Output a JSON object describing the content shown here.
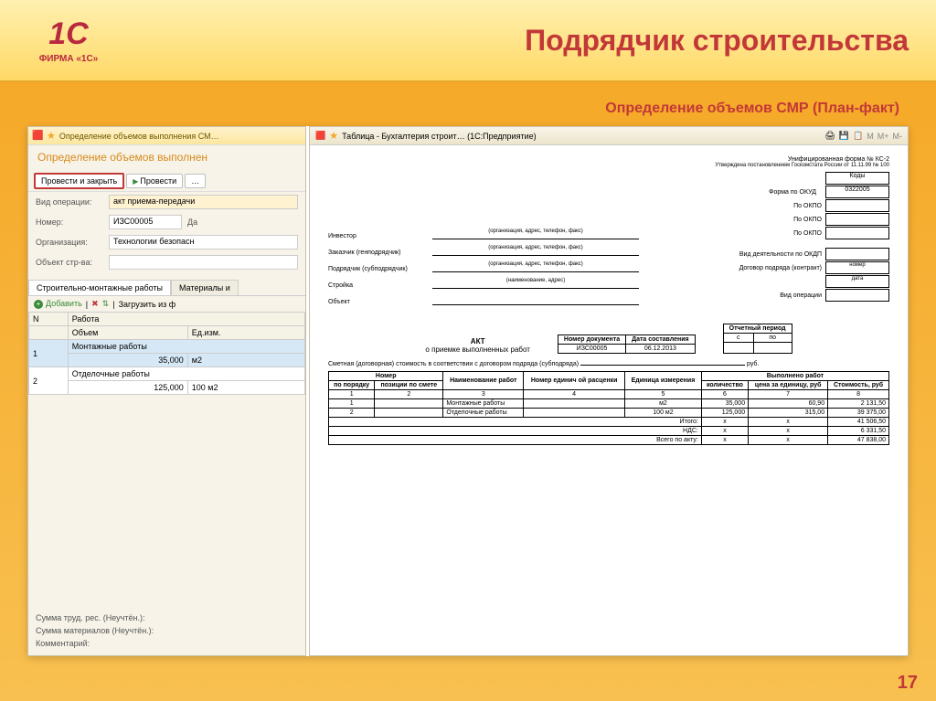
{
  "logo_text": "ФИРМА «1С»",
  "page_title": "Подрядчик строительства",
  "subtitle": "Определение объемов СМР (План-факт)",
  "page_number": "17",
  "app": {
    "titlebar": "Определение объемов выполнения СМ…",
    "form_title": "Определение объемов выполнен",
    "btn_primary": "Провести и закрыть",
    "btn_post": "Провести",
    "fields": {
      "operation_label": "Вид операции:",
      "operation_value": "акт приема-передачи",
      "number_label": "Номер:",
      "number_value": "ИЗС00005",
      "date_label": "Да",
      "org_label": "Организация:",
      "org_value": "Технологии безопасн",
      "object_label": "Объект стр-ва:",
      "object_value": ""
    },
    "tab_main": "Строительно-монтажные работы",
    "tab_materials": "Материалы и",
    "add_button": "Добавить",
    "load_button": "Загрузить из ф",
    "table_headers": {
      "n": "N",
      "work": "Работа",
      "volume": "Объем",
      "unit": "Ед.изм."
    },
    "rows": [
      {
        "n": "1",
        "work": "Монтажные работы",
        "volume": "35,000",
        "unit": "м2"
      },
      {
        "n": "2",
        "work": "Отделочные работы",
        "volume": "125,000",
        "unit": "100 м2"
      }
    ],
    "footer": {
      "labor": "Сумма труд. рес. (Неучтён.):",
      "materials": "Сумма материалов (Неучтён.):",
      "comment": "Комментарий:"
    }
  },
  "report": {
    "titlebar": "Таблица - Бухгалтерия строит… (1С:Предприятие)",
    "form_note": "Унифицированная форма № КС-2",
    "approved": "Утверждена постановлением Госкомстата России от 11.11.99 № 100",
    "kod_label": "Коды",
    "okud_label": "Форма по ОКУД",
    "okud_value": "0322005",
    "okpo_label": "По ОКПО",
    "left_labels": {
      "investor": "Инвестор",
      "customer": "Заказчик (генподрядчик)",
      "contractor": "Подрядчик (субподрядчик)",
      "building": "Стройка",
      "object": "Объект"
    },
    "hint": "(организация, адрес, телефон, факс)",
    "hint2": "(наименование, адрес)",
    "okdp_label": "Вид деятельности по ОКДП",
    "contract_label": "Договор подряда (контракт)",
    "contract_sub": "номер",
    "contract_date": "дата",
    "op_type_label": "Вид операции",
    "doc_num_h": "Номер документа",
    "doc_date_h": "Дата составления",
    "doc_num": "ИЗС00005",
    "doc_date": "06.12.2013",
    "period_h": "Отчетный период",
    "period_from": "с",
    "period_to": "по",
    "akt_title": "АКТ",
    "akt_sub": "о приемке выполненных работ",
    "cost_line": "Сметная (договорная) стоимость в соответствии с договором подряда (субподряда)",
    "cost_rub": "руб.",
    "main_headers": {
      "number": "Номер",
      "po_poryadku": "по порядку",
      "po_smete": "позиции по смете",
      "name": "Наименование работ",
      "unit_num": "Номер единич ой расценки",
      "unit": "Единица измерения",
      "done": "Выполнено работ",
      "qty": "количество",
      "price": "цена за единицу, руб",
      "cost": "Стоимость, руб"
    },
    "col_nums": [
      "1",
      "2",
      "3",
      "4",
      "5",
      "6",
      "7",
      "8"
    ],
    "main_rows": [
      {
        "n": "1",
        "pos": "",
        "name": "Монтажные работы",
        "unit_num": "",
        "unit": "м2",
        "qty": "35,000",
        "price": "60,90",
        "cost": "2 131,50"
      },
      {
        "n": "2",
        "pos": "",
        "name": "Отделочные работы",
        "unit_num": "",
        "unit": "100 м2",
        "qty": "125,000",
        "price": "315,00",
        "cost": "39 375,00"
      }
    ],
    "totals": {
      "itogo_label": "Итого:",
      "itogo": "41 506,50",
      "nds_label": "НДС:",
      "nds": "6 331,50",
      "all_label": "Всего по акту:",
      "all": "47 838,00",
      "x": "x"
    }
  }
}
